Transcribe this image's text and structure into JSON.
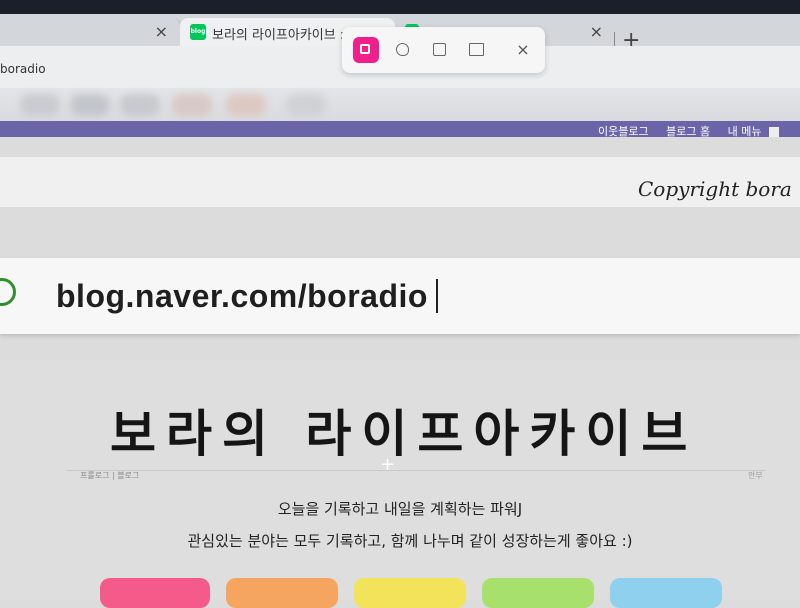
{
  "tabs": [
    {
      "label": "",
      "close": "×"
    },
    {
      "label": "보라의 라이프아카이브 : 네이버",
      "close": "×",
      "favicon": "blog"
    },
    {
      "label": "",
      "close": "×"
    }
  ],
  "new_tab": "+",
  "address_bar": {
    "text": "boradio"
  },
  "capture_toolbar": {
    "close": "×"
  },
  "blog_nav": {
    "items": [
      "이웃블로그",
      "블로그 홈",
      "내 메뉴"
    ]
  },
  "header": {
    "copyright": "Copyright bora"
  },
  "url_overlay": {
    "text": "blog.naver.com/boradio"
  },
  "hero": {
    "title": "보라의 라이프아카이브",
    "small_left": "프롤로그 | 블로그",
    "small_right": "안부",
    "tagline_1": "오늘을 기록하고 내일을 계획하는 파워J",
    "tagline_2": "관심있는 분야는 모두 기록하고, 함께 나누며 같이 성장하는게 좋아요 :)"
  },
  "colors": {
    "nav_bar": "#6b64a8",
    "capture_active": "#ef1f8c",
    "favicon": "#03c75a"
  },
  "icons": [
    "rectangle-capture-icon",
    "freeform-capture-icon",
    "window-capture-icon",
    "fullscreen-capture-icon",
    "close-icon",
    "search-icon",
    "blog-favicon-icon"
  ]
}
